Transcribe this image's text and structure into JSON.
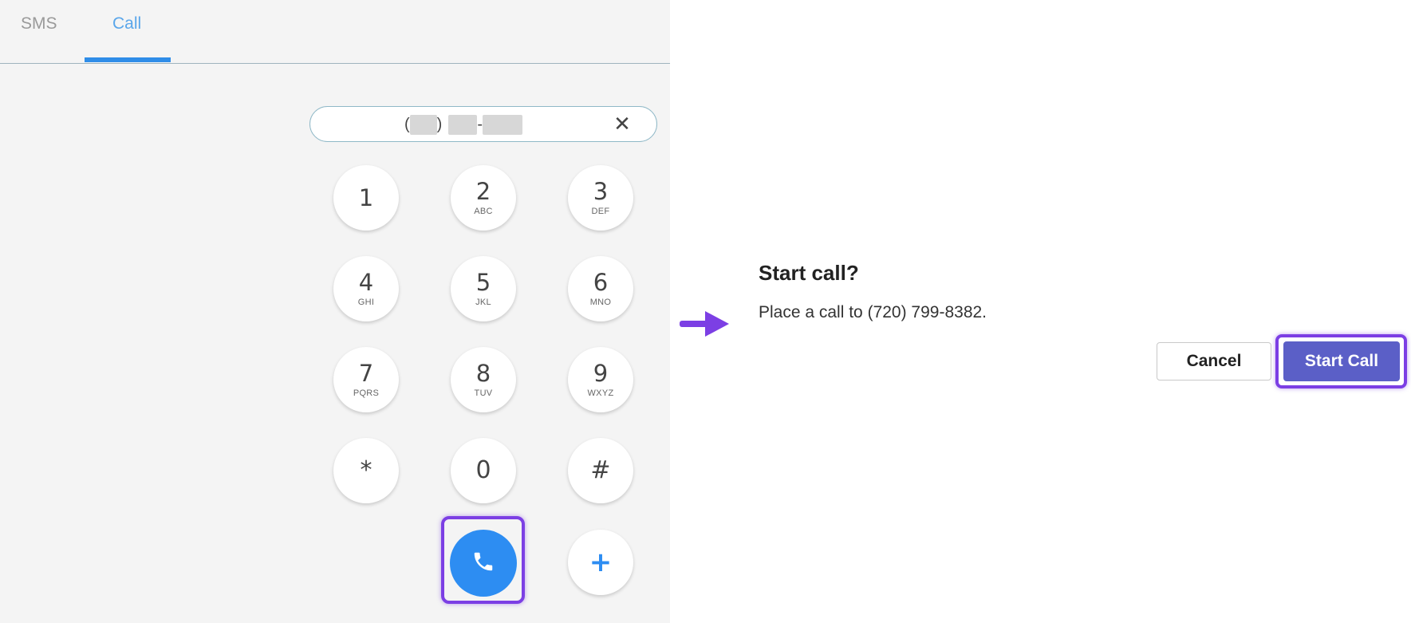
{
  "tabs": [
    {
      "label": "SMS",
      "active": false
    },
    {
      "label": "Call",
      "active": true
    }
  ],
  "dialer": {
    "number_display": {
      "open_paren": "(",
      "close_paren": ")",
      "dash": "-",
      "redacted": true
    },
    "clear_icon": "close-icon",
    "keys": [
      {
        "digit": "1",
        "letters": ""
      },
      {
        "digit": "2",
        "letters": "ABC"
      },
      {
        "digit": "3",
        "letters": "DEF"
      },
      {
        "digit": "4",
        "letters": "GHI"
      },
      {
        "digit": "5",
        "letters": "JKL"
      },
      {
        "digit": "6",
        "letters": "MNO"
      },
      {
        "digit": "7",
        "letters": "PQRS"
      },
      {
        "digit": "8",
        "letters": "TUV"
      },
      {
        "digit": "9",
        "letters": "WXYZ"
      },
      {
        "digit": "*",
        "letters": ""
      },
      {
        "digit": "0",
        "letters": ""
      },
      {
        "digit": "#",
        "letters": ""
      }
    ],
    "call_icon": "phone-icon",
    "plus_label": "+"
  },
  "dialog": {
    "title": "Start call?",
    "message": "Place a call to (720) 799-8382.",
    "cancel_label": "Cancel",
    "confirm_label": "Start Call"
  },
  "colors": {
    "accent_blue": "#2d8df2",
    "highlight_purple": "#7c3fe4",
    "primary_button": "#5b5fc7"
  }
}
